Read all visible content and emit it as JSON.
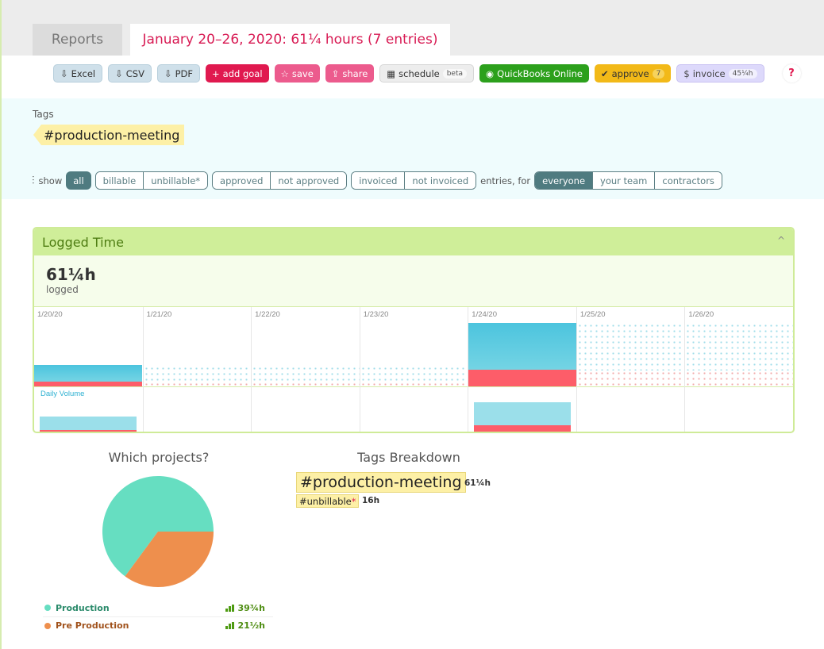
{
  "tabs": {
    "reports": "Reports",
    "current": "January 20–26, 2020: 61¼ hours (7 entries)"
  },
  "toolbar": {
    "excel": "Excel",
    "csv": "CSV",
    "pdf": "PDF",
    "add_goal": "add goal",
    "save": "save",
    "share": "share",
    "schedule": "schedule",
    "schedule_badge": "beta",
    "quickbooks": "QuickBooks Online",
    "approve": "approve",
    "approve_count": "7",
    "invoice": "invoice",
    "invoice_hours": "45¼h",
    "help": "?"
  },
  "filters": {
    "tags_label": "Tags",
    "active_tag": "#production-meeting",
    "show_label": "show",
    "all": "all",
    "billable": "billable",
    "unbillable": "unbillable*",
    "approved": "approved",
    "not_approved": "not approved",
    "invoiced": "invoiced",
    "not_invoiced": "not invoiced",
    "entries_for": "entries, for",
    "everyone": "everyone",
    "your_team": "your team",
    "contractors": "contractors"
  },
  "logged_time": {
    "title": "Logged Time",
    "total": "61¼h",
    "total_label": "logged",
    "daily_volume_label": "Daily Volume",
    "days": [
      {
        "label": "1/20/20",
        "billable_frac": 0.26,
        "unbillable_frac": 0.08,
        "vol_billable": 0.35,
        "vol_unbillable": 0.1
      },
      {
        "label": "1/21/20",
        "billable_frac": 0,
        "unbillable_frac": 0
      },
      {
        "label": "1/22/20",
        "billable_frac": 0,
        "unbillable_frac": 0
      },
      {
        "label": "1/23/20",
        "billable_frac": 0,
        "unbillable_frac": 0
      },
      {
        "label": "1/24/20",
        "billable_frac": 0.74,
        "unbillable_frac": 0.26,
        "vol_billable": 0.62,
        "vol_unbillable": 0.22
      },
      {
        "label": "1/25/20",
        "billable_frac": 0,
        "unbillable_frac": 0
      },
      {
        "label": "1/26/20",
        "billable_frac": 0,
        "unbillable_frac": 0
      }
    ]
  },
  "projects": {
    "title": "Which projects?",
    "items": [
      {
        "name": "Production",
        "hours": "39¾h",
        "value": 39.75,
        "color": "#66dec1",
        "text_color": "#2a8a6a"
      },
      {
        "name": "Pre Production",
        "hours": "21½h",
        "value": 21.5,
        "color": "#ee8f4d",
        "text_color": "#a0521c"
      }
    ]
  },
  "tags_breakdown": {
    "title": "Tags Breakdown",
    "main_tag": "#production-meeting",
    "main_hours": "61¼h",
    "sub_tag": "#unbillable",
    "sub_star": "*",
    "sub_hours": "16h"
  }
}
